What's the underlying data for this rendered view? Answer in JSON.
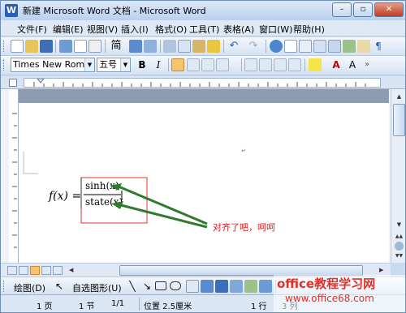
{
  "window": {
    "title": "新建 Microsoft Word 文档 - Microsoft Word",
    "minimize": "–",
    "restore": "▫",
    "close": "✕"
  },
  "menu": {
    "items": [
      "文件(F)",
      "编辑(E)",
      "视图(V)",
      "插入(I)",
      "格式(O)",
      "工具(T)",
      "表格(A)",
      "窗口(W)",
      "帮助(H)"
    ]
  },
  "format_toolbar": {
    "font_name": "Times New Roman",
    "font_size": "五号",
    "bold": "B",
    "italic": "I"
  },
  "standard_toolbar": {
    "style_glyph": "简"
  },
  "document": {
    "function_lhs": "f(x) =",
    "numerator": "sinh(x)",
    "denominator": "state(x)",
    "annotation": "对齐了吧，呵呵",
    "arrow_color": "#2f7a2f",
    "highlight_color": "#e03030",
    "annotation_color": "#d02020"
  },
  "draw_toolbar": {
    "draw_label": "绘图(D)",
    "autoshape_label": "自选图形(U)"
  },
  "status": {
    "page": "1 页",
    "section": "1 节",
    "pages": "1/1",
    "position": "位置 2.5厘米",
    "line": "1 行",
    "col": "3 列"
  },
  "watermark": {
    "site_cn": "office教程学习网",
    "site_url": "www.office68.com"
  }
}
